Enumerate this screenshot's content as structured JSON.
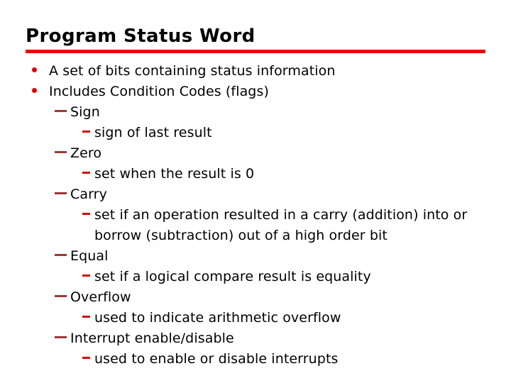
{
  "slide": {
    "title": "Program Status Word",
    "accent_color": "#f00000",
    "bullet_color_level1": "#e00000",
    "bullet_color_level2": "#9e3636",
    "bullet_color_level3": "#cc1111",
    "text_color": "#000000",
    "background_color": "#ffffff",
    "markers": {
      "level1": "bullet-dot",
      "level2": "em-dash",
      "level3": "en-dash"
    },
    "bullets": [
      {
        "level": 1,
        "text": "A set of bits containing status information"
      },
      {
        "level": 1,
        "text": "Includes Condition Codes (flags)"
      },
      {
        "level": 2,
        "text": "Sign"
      },
      {
        "level": 3,
        "text": "sign of last result"
      },
      {
        "level": 2,
        "text": "Zero"
      },
      {
        "level": 3,
        "text": "set when the result is 0"
      },
      {
        "level": 2,
        "text": "Carry"
      },
      {
        "level": 3,
        "text": "set if an operation resulted in a carry (addition) into or borrow (subtraction) out of a high order bit"
      },
      {
        "level": 2,
        "text": "Equal"
      },
      {
        "level": 3,
        "text": "set if a logical compare result is equality"
      },
      {
        "level": 2,
        "text": "Overflow"
      },
      {
        "level": 3,
        "text": "used to indicate arithmetic overflow"
      },
      {
        "level": 2,
        "text": "Interrupt enable/disable"
      },
      {
        "level": 3,
        "text": "used to enable or disable interrupts"
      }
    ]
  }
}
